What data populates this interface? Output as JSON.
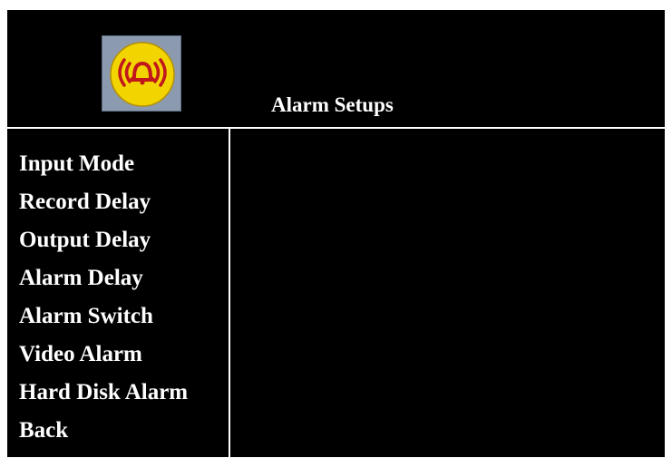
{
  "header": {
    "title": "Alarm Setups",
    "icon": "alarm-bell-icon"
  },
  "menu": {
    "items": [
      {
        "label": "Input Mode"
      },
      {
        "label": "Record Delay"
      },
      {
        "label": "Output Delay"
      },
      {
        "label": "Alarm Delay"
      },
      {
        "label": "Alarm Switch"
      },
      {
        "label": "Video Alarm"
      },
      {
        "label": "Hard Disk Alarm"
      },
      {
        "label": "Back"
      }
    ]
  },
  "colors": {
    "background": "#000000",
    "text": "#ffffff",
    "icon_tile": "#8c9aaf",
    "icon_disc": "#f2d500",
    "icon_glyph": "#c0171c"
  }
}
